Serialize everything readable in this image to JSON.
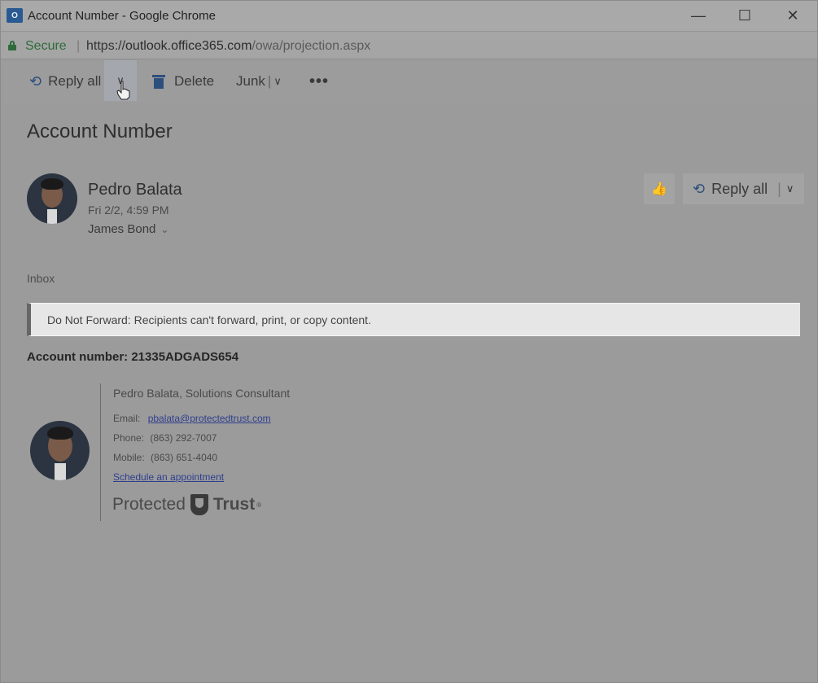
{
  "window": {
    "title": "Account Number - Google Chrome",
    "app_icon": "O",
    "minimize": "—",
    "maximize": "☐",
    "close": "✕"
  },
  "address": {
    "secure_label": "Secure",
    "separator": "|",
    "scheme": "https://",
    "host": "outlook.office365.com",
    "path": "/owa/projection.aspx"
  },
  "toolbar": {
    "reply_all_label": "Reply all",
    "delete_label": "Delete",
    "junk_label": "Junk",
    "junk_sep": "|",
    "more_label": "•••"
  },
  "message": {
    "subject": "Account Number",
    "sender": "Pedro Balata",
    "date": "Fri 2/2, 4:59 PM",
    "recipient": "James Bond",
    "reply_all_label": "Reply all",
    "folder": "Inbox",
    "banner": "Do Not Forward: Recipients can't forward, print, or copy content.",
    "body": "Account number: 21335ADGADS654"
  },
  "signature": {
    "name": "Pedro Balata, Solutions Consultant",
    "email_label": "Email:",
    "email": "pbalata@protectedtrust.com",
    "phone_label": "Phone:",
    "phone": "(863) 292-7007",
    "mobile_label": "Mobile:",
    "mobile": "(863) 651-4040",
    "schedule_link": "Schedule an appointment",
    "logo_left": "Protected",
    "logo_right": "Trust",
    "logo_mark": "®"
  },
  "colors": {
    "secure_green": "#2f6b3b",
    "icon_blue": "#2d4f7c",
    "link_blue": "#2f3f8e"
  },
  "icons": {
    "reply_all": "reply-all-icon",
    "delete": "trash-icon",
    "like": "thumbs-up-icon",
    "lock": "lock-icon"
  }
}
